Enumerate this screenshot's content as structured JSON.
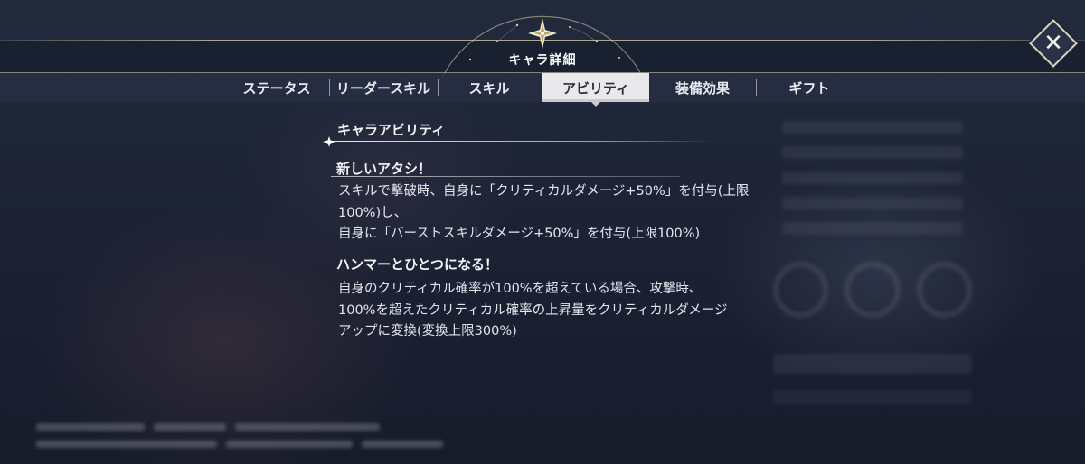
{
  "window": {
    "title": "キャラ詳細",
    "close_icon": "close-icon"
  },
  "tabs": [
    {
      "label": "ステータス",
      "active": false
    },
    {
      "label": "リーダースキル",
      "active": false
    },
    {
      "label": "スキル",
      "active": false
    },
    {
      "label": "アビリティ",
      "active": true
    },
    {
      "label": "装備効果",
      "active": false
    },
    {
      "label": "ギフト",
      "active": false
    }
  ],
  "section": {
    "title": "キャラアビリティ"
  },
  "abilities": [
    {
      "name": "新しいアタシ！",
      "description": [
        "スキルで撃破時、自身に「クリティカルダメージ+50%」を付与(上限",
        "100%)し、",
        "自身に「バーストスキルダメージ+50%」を付与(上限100%)"
      ]
    },
    {
      "name": "ハンマーとひとつになる！",
      "description": [
        "自身のクリティカル確率が100%を超えている場合、攻撃時、",
        "100%を超えたクリティカル確率の上昇量をクリティカルダメージ",
        "アップに変換(変換上限300%)"
      ]
    }
  ],
  "colors": {
    "background": "#1c2234",
    "tab_active_bg": "#e9e9ec",
    "tab_active_text": "#2a2f40",
    "accent_gold": "#d9d4bf"
  }
}
